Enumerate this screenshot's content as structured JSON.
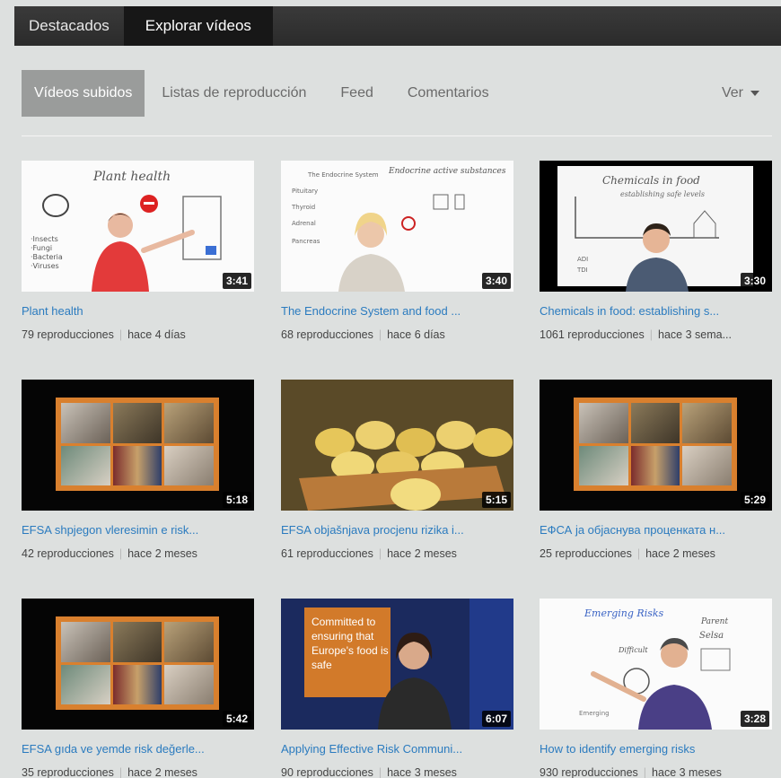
{
  "nav": {
    "tabs": [
      {
        "label": "Destacados",
        "active": false
      },
      {
        "label": "Explorar vídeos",
        "active": true
      }
    ]
  },
  "subnav": {
    "items": [
      {
        "label": "Vídeos subidos",
        "active": true
      },
      {
        "label": "Listas de reproducción"
      },
      {
        "label": "Feed"
      },
      {
        "label": "Comentarios"
      }
    ],
    "view_label": "Ver"
  },
  "videos": [
    {
      "title": "Plant health",
      "views": "79 reproducciones",
      "age": "hace 4 días",
      "duration": "3:41",
      "thumb": "whiteboard-woman-red"
    },
    {
      "title": "The Endocrine System and food ...",
      "views": "68 reproducciones",
      "age": "hace 6 días",
      "duration": "3:40",
      "thumb": "whiteboard-woman-blonde"
    },
    {
      "title": "Chemicals in food: establishing s...",
      "views": "1061 reproducciones",
      "age": "hace 3 sema...",
      "duration": "3:30",
      "thumb": "whiteboard-man"
    },
    {
      "title": "EFSA shpjegon vleresimin e risk...",
      "views": "42 reproducciones",
      "age": "hace 2 meses",
      "duration": "5:18",
      "thumb": "orange-mosaic"
    },
    {
      "title": "EFSA objašnjava procjenu rizika i...",
      "views": "61 reproducciones",
      "age": "hace 2 meses",
      "duration": "5:15",
      "thumb": "melons"
    },
    {
      "title": "ЕФСА ја објаснува проценката н...",
      "views": "25 reproducciones",
      "age": "hace 2 meses",
      "duration": "5:29",
      "thumb": "orange-mosaic"
    },
    {
      "title": "EFSA gıda ve yemde risk değerle...",
      "views": "35 reproducciones",
      "age": "hace 2 meses",
      "duration": "5:42",
      "thumb": "orange-mosaic"
    },
    {
      "title": "Applying Effective Risk Communi...",
      "views": "90 reproducciones",
      "age": "hace 3 meses",
      "duration": "6:07",
      "thumb": "blue-woman",
      "thumb_text": "Committed to ensuring that Europe's food is safe"
    },
    {
      "title": "How to identify emerging risks",
      "views": "930 reproducciones",
      "age": "hace 3 meses",
      "duration": "3:28",
      "thumb": "whiteboard-man-purple"
    }
  ],
  "colors": {
    "link": "#2b7bbf",
    "background": "#dde0df",
    "topbar": "#2b2b2b",
    "active_subtab": "#9a9c9b"
  }
}
